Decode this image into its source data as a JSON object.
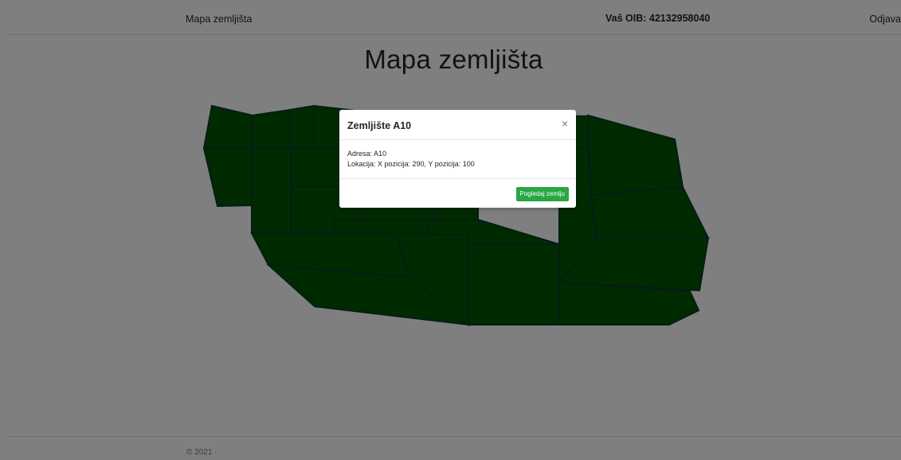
{
  "navbar": {
    "brand": "Mapa zemljišta",
    "oib_text": "Vaš OIB: 42132958040",
    "logout": "Odjava"
  },
  "page": {
    "title": "Mapa zemljišta"
  },
  "footer": {
    "text": "© 2021 ·"
  },
  "modal": {
    "title": "Zemljište A10",
    "close_icon": "close-icon",
    "address_line": "Adresa: A10",
    "location_line": "Lokacija: X pozicija: 290, Y pozicija: 100",
    "button_label": "Pogledaj zemlju"
  },
  "colors": {
    "parcel_fill": "#005500",
    "parcel_stroke": "#0b3a2c",
    "button": "#28a745"
  }
}
